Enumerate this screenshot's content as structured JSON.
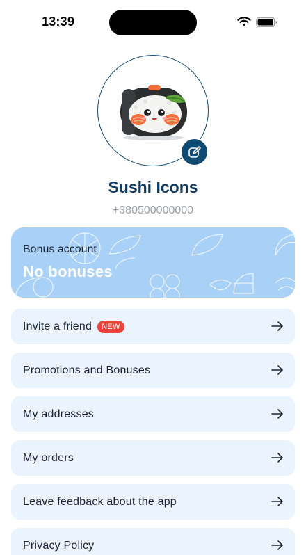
{
  "status_bar": {
    "time": "13:39"
  },
  "profile": {
    "name": "Sushi Icons",
    "phone": "+380500000000"
  },
  "bonus": {
    "title": "Bonus account",
    "value": "No bonuses"
  },
  "menu": {
    "items": [
      {
        "label": "Invite a friend",
        "badge": "NEW"
      },
      {
        "label": "Promotions and Bonuses"
      },
      {
        "label": "My addresses"
      },
      {
        "label": "My orders"
      },
      {
        "label": "Leave feedback about the app"
      },
      {
        "label": "Privacy Policy"
      }
    ]
  },
  "colors": {
    "accent": "#0f4a73",
    "bonus_card": "#a9d0f7",
    "menu_bg": "#eaf4fe",
    "badge": "#e8443a"
  }
}
